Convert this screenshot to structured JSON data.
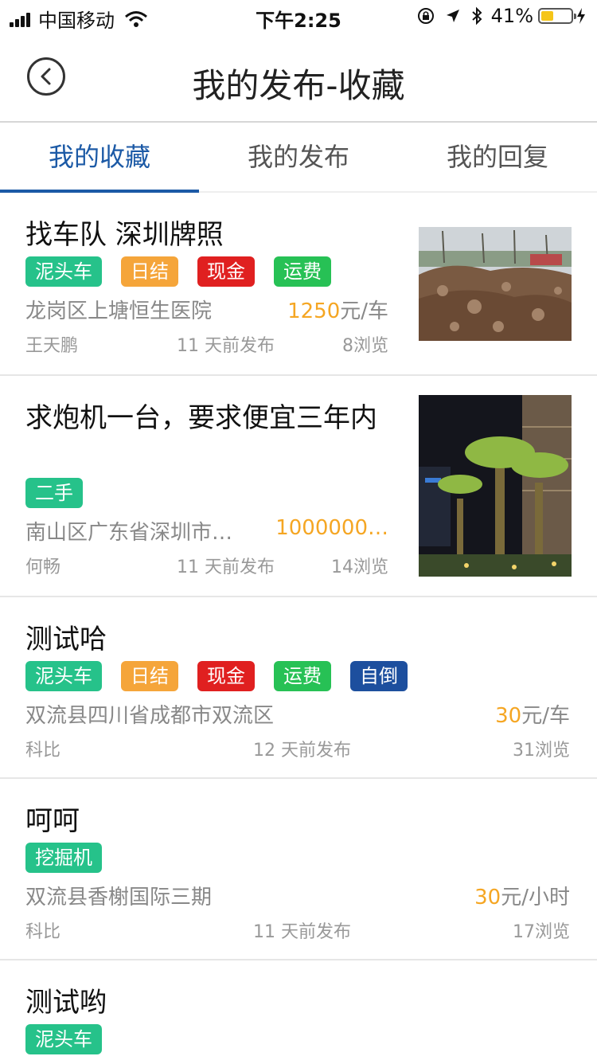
{
  "status": {
    "carrier": "中国移动",
    "time": "下午2:25",
    "battery": "41%",
    "battery_level": 0.41
  },
  "nav": {
    "title": "我的发布-收藏"
  },
  "tabs": [
    "我的收藏",
    "我的发布",
    "我的回复"
  ],
  "items": [
    {
      "title": "找车队 深圳牌照",
      "tags": [
        {
          "label": "泥头车",
          "color": "#26c28a"
        },
        {
          "label": "日结",
          "color": "#f5a53a"
        },
        {
          "label": "现金",
          "color": "#e02020"
        },
        {
          "label": "运费",
          "color": "#27c155"
        }
      ],
      "address": "龙岗区上塘恒生医院",
      "price": "1250",
      "unit": "元/车",
      "user": "王天鹏",
      "time": "11 天前发布",
      "views": "8浏览",
      "image": "construction-dirt-photo"
    },
    {
      "title": "求炮机一台，要求便宜三年内",
      "tags": [
        {
          "label": "二手",
          "color": "#26c28a"
        }
      ],
      "address": "南山区广东省深圳市…",
      "price": "1000000…",
      "unit": "",
      "user": "何畅",
      "time": "11 天前发布",
      "views": "14浏览",
      "image": "palm-trees-night-photo"
    },
    {
      "title": "测试哈",
      "tags": [
        {
          "label": "泥头车",
          "color": "#26c28a"
        },
        {
          "label": "日结",
          "color": "#f5a53a"
        },
        {
          "label": "现金",
          "color": "#e02020"
        },
        {
          "label": "运费",
          "color": "#27c155"
        },
        {
          "label": "自倒",
          "color": "#1d4f9e"
        }
      ],
      "address": "双流县四川省成都市双流区",
      "price": "30",
      "unit": "元/车",
      "user": "科比",
      "time": "12 天前发布",
      "views": "31浏览"
    },
    {
      "title": "呵呵",
      "tags": [
        {
          "label": "挖掘机",
          "color": "#26c28a"
        }
      ],
      "address": "双流县香榭国际三期",
      "price": "30",
      "unit": "元/小时",
      "user": "科比",
      "time": "11 天前发布",
      "views": "17浏览"
    },
    {
      "title": "测试哟",
      "tags": [
        {
          "label": "泥头车",
          "color": "#26c28a"
        }
      ]
    }
  ]
}
